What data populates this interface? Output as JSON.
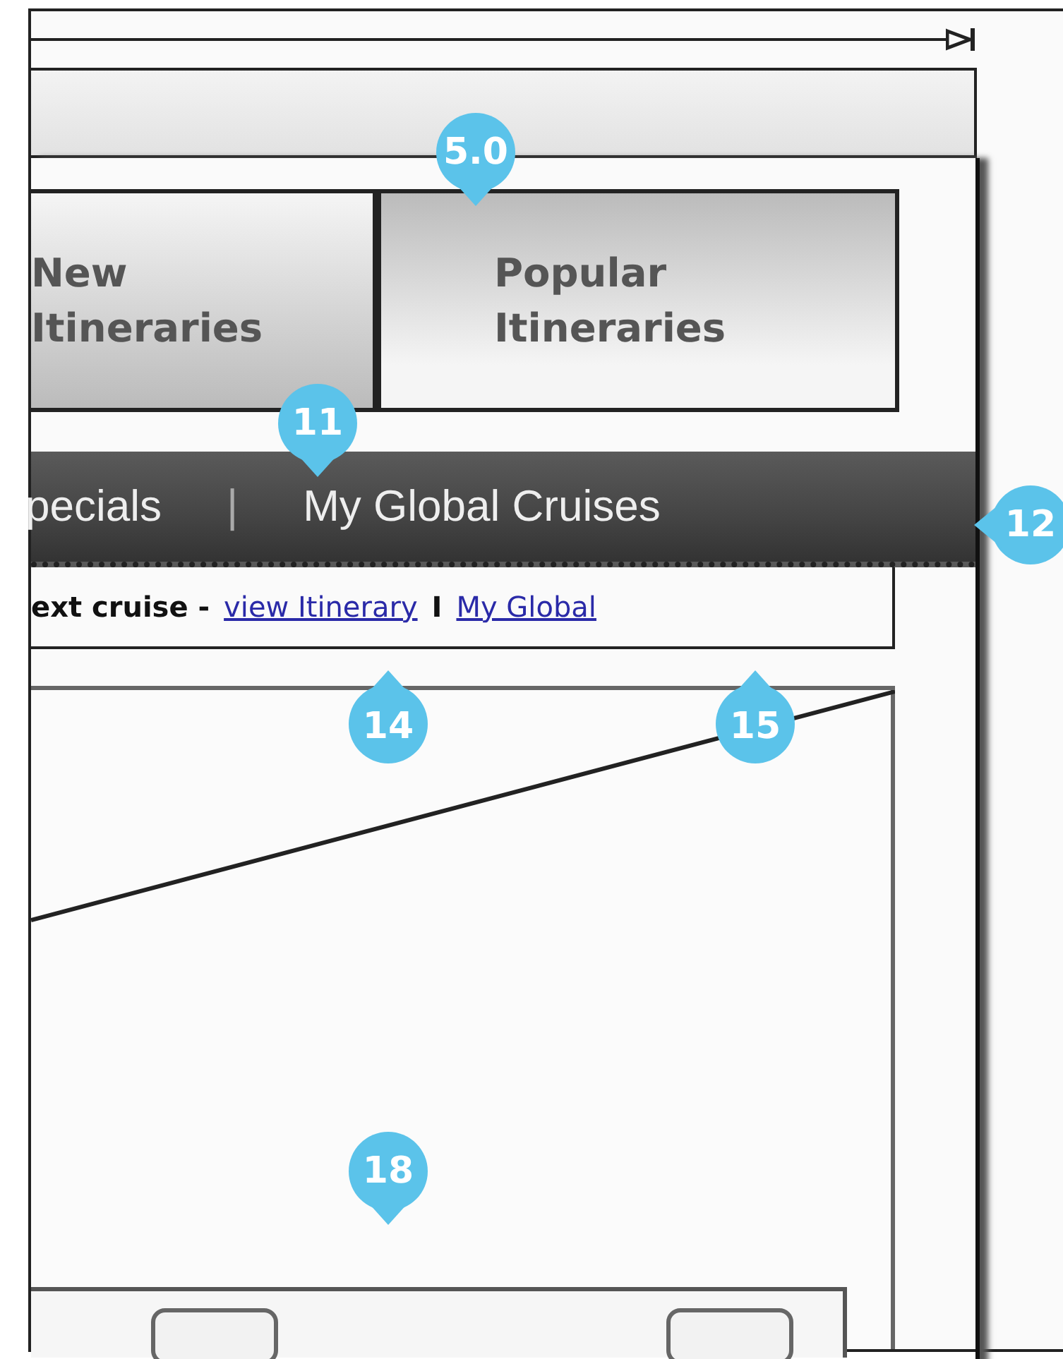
{
  "tabs": [
    {
      "line1": "New",
      "line2": "Itineraries",
      "selected": false
    },
    {
      "line1": "Popular",
      "line2": "Itineraries",
      "selected": true
    }
  ],
  "nav": {
    "items": [
      "pecials",
      "My Global Cruises"
    ],
    "separator": "|"
  },
  "links_row": {
    "prefix": "ext cruise -",
    "links": [
      "view Itinerary",
      "My Global"
    ],
    "separator": "I"
  },
  "annotations": [
    {
      "label": "5.0",
      "kind": "down"
    },
    {
      "label": "11",
      "kind": "down"
    },
    {
      "label": "12",
      "kind": "left"
    },
    {
      "label": "14",
      "kind": "up"
    },
    {
      "label": "15",
      "kind": "up"
    },
    {
      "label": "18",
      "kind": "down"
    }
  ]
}
